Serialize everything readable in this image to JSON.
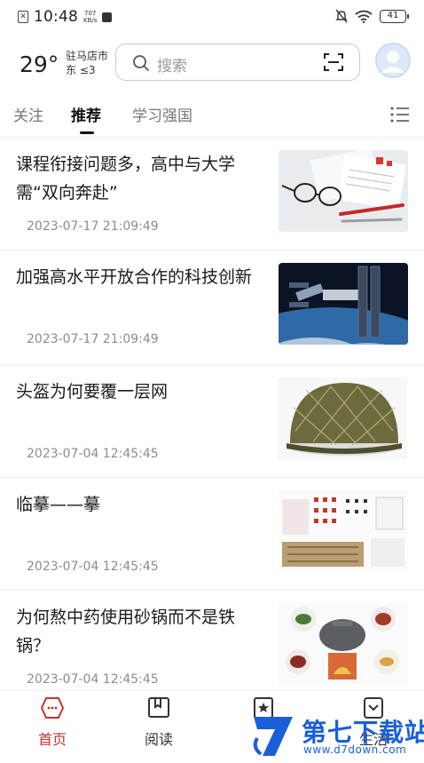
{
  "status_bar": {
    "time": "10:48",
    "net_speed_value": "707",
    "net_speed_unit": "KB/s",
    "battery": "41"
  },
  "header": {
    "temperature": "29°",
    "location_line1": "驻马店市",
    "location_line2": "东 ≤3",
    "search_placeholder": "搜索"
  },
  "tabs": [
    {
      "label": "关注",
      "active": false
    },
    {
      "label": "推荐",
      "active": true
    },
    {
      "label": "学习强国",
      "active": false
    }
  ],
  "feed": [
    {
      "title": "课程衔接问题多，高中与大学需“双向奔赴”",
      "date": "2023-07-17 21:09:49"
    },
    {
      "title": "加强高水平开放合作的科技创新",
      "date": "2023-07-17 21:09:49"
    },
    {
      "title": "头盔为何要覆一层网",
      "date": "2023-07-04 12:45:45"
    },
    {
      "title": "临摹——摹",
      "date": "2023-07-04 12:45:45"
    },
    {
      "title": "为何熬中药使用砂锅而不是铁锅？",
      "date": "2023-07-04 12:45:45"
    }
  ],
  "bottom_nav": [
    {
      "label": "首页",
      "icon": "home-icon",
      "active": true
    },
    {
      "label": "阅读",
      "icon": "book-icon",
      "active": false
    },
    {
      "label": "",
      "icon": "star-icon",
      "active": false
    },
    {
      "label": "生活",
      "icon": "life-icon",
      "active": false
    }
  ],
  "watermark": {
    "text": "第七下载站",
    "url": "www.d7down.com"
  },
  "colors": {
    "accent": "#c8322a",
    "watermark": "#1b5fd8"
  }
}
